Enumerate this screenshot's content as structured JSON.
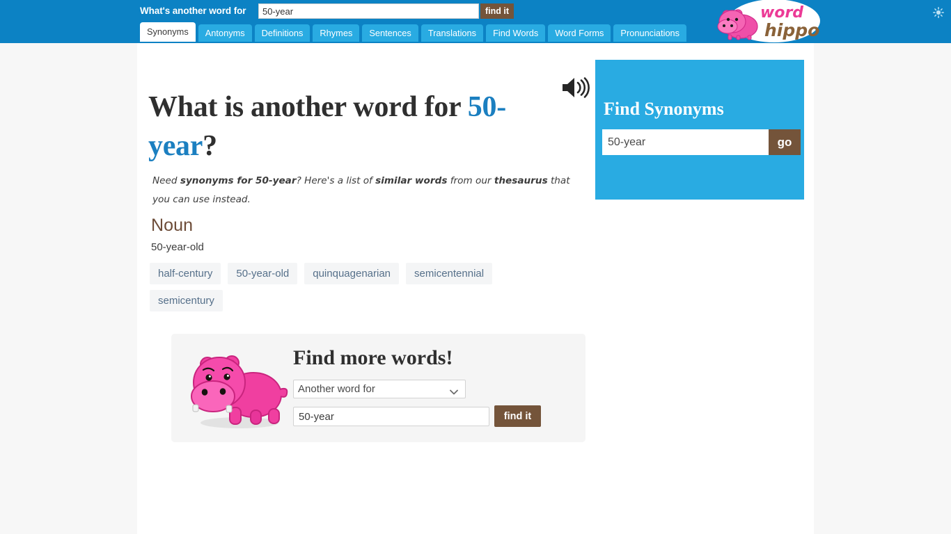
{
  "header": {
    "prompt_label": "What's another word for",
    "search_value": "50-year",
    "find_button": "find it",
    "theme_icon": "sun-icon"
  },
  "tabs": [
    {
      "label": "Synonyms",
      "active": true
    },
    {
      "label": "Antonyms",
      "active": false
    },
    {
      "label": "Definitions",
      "active": false
    },
    {
      "label": "Rhymes",
      "active": false
    },
    {
      "label": "Sentences",
      "active": false
    },
    {
      "label": "Translations",
      "active": false
    },
    {
      "label": "Find Words",
      "active": false
    },
    {
      "label": "Word Forms",
      "active": false
    },
    {
      "label": "Pronunciations",
      "active": false
    }
  ],
  "logo": {
    "word_text": "word",
    "hippo_text": "hippo"
  },
  "main": {
    "headline_prefix": "What is another word for ",
    "headline_word": "50-year",
    "headline_suffix": "?",
    "speaker_icon": "speaker-icon",
    "blurb_1": "Need ",
    "blurb_b1": "synonyms for 50-year",
    "blurb_2": "? Here's a list of ",
    "blurb_b2": "similar words",
    "blurb_3": " from our ",
    "blurb_b3": "thesaurus",
    "blurb_4": " that you can use instead.",
    "part_of_speech": "Noun",
    "sense": "50-year-old",
    "synonyms": [
      "half-century",
      "50-year-old",
      "quinquagenarian",
      "semicentennial",
      "semicentury"
    ]
  },
  "widget": {
    "title": "Find more words!",
    "select_value": "Another word for",
    "select_options": [
      "Another word for"
    ],
    "input_value": "50-year",
    "button_label": "find it",
    "mascot": "hippo-mascot"
  },
  "sidebar": {
    "title": "Find Synonyms",
    "input_value": "50-year",
    "go_label": "go"
  },
  "colors": {
    "header_blue": "#0c82c4",
    "tab_blue": "#29abe2",
    "brown": "#74543a",
    "link_blue": "#1b7fc0",
    "noun_brown": "#6d4c38",
    "chip_bg": "#f4f5f6",
    "chip_text": "#56708a",
    "hippo_pink": "#f03fa0"
  }
}
